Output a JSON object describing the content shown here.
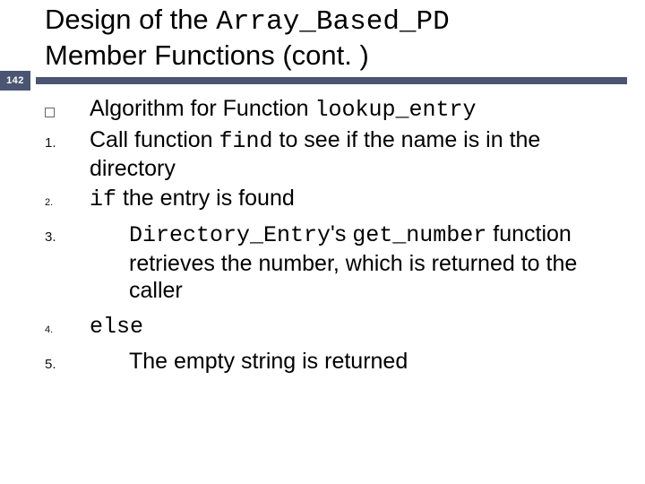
{
  "page_number": "142",
  "title": {
    "part1": "Design of the ",
    "code1": "Array_Based_PD",
    "part2": "Member Functions (cont. )"
  },
  "heading": {
    "prefix": "Algorithm for Function ",
    "code": "lookup_entry"
  },
  "item1": {
    "num": "1.",
    "prefix": "Call function ",
    "code": "find",
    "suffix": " to see if the name is in the directory"
  },
  "item2": {
    "num": "2.",
    "code": "if",
    "suffix": " the entry is found"
  },
  "item3": {
    "num": "3.",
    "code1": "Directory_Entry",
    "mid1": "'s ",
    "code2": "get_number",
    "suffix": " function retrieves the number, which is returned to the caller"
  },
  "item4": {
    "num": "4.",
    "code": "else"
  },
  "item5": {
    "num": "5.",
    "text": "The empty string is returned"
  }
}
